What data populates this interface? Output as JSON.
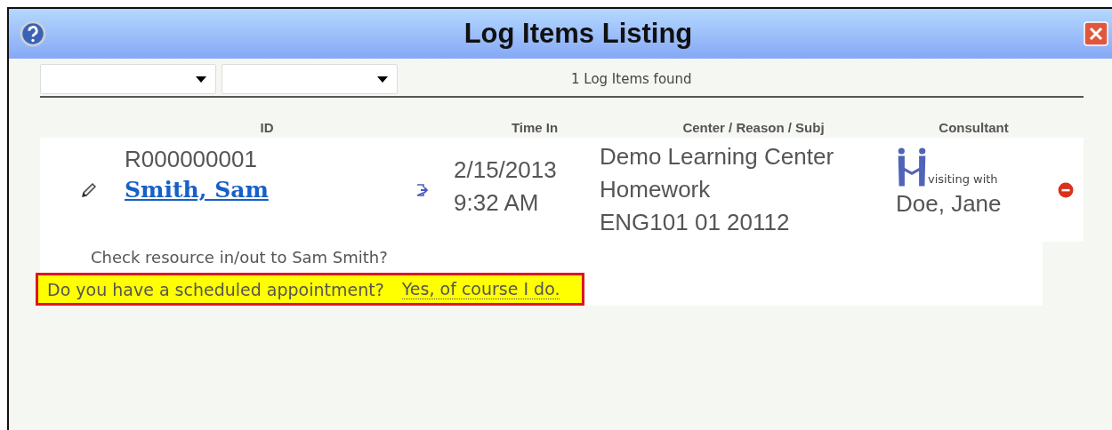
{
  "window": {
    "title": "Log Items Listing"
  },
  "filters": [
    {
      "kind": "dropdown"
    },
    {
      "kind": "dropdown"
    }
  ],
  "result_count": "1 Log Items found",
  "columns": [
    "ID",
    "Time In",
    "Center / Reason / Subj",
    "Consultant"
  ],
  "rows": [
    {
      "id": "R000000001",
      "name": "Smith, Sam",
      "time_in": [
        "2/15/2013",
        "9:32 AM"
      ],
      "center_reason_subj": [
        "Demo Learning Center",
        "Homework",
        "ENG101 01 20112"
      ],
      "consultant_note": "visiting with",
      "consultant": "Doe, Jane"
    }
  ],
  "prompt": "Check resource in/out to Sam Smith?",
  "appointment": {
    "question": "Do you have a scheduled appointment?",
    "answer": "Yes, of course I do."
  }
}
